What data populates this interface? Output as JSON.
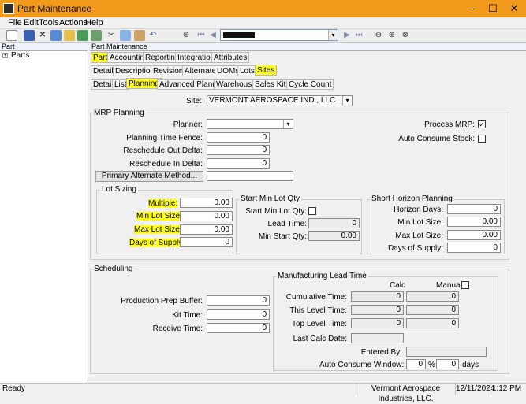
{
  "window": {
    "title": "Part Maintenance"
  },
  "menu": [
    "File",
    "Edit",
    "Tools",
    "Actions",
    "Help"
  ],
  "toolbar": {
    "search_value": ""
  },
  "left": {
    "header": "Part",
    "tree_item": "Parts"
  },
  "main": {
    "header": "Part Maintenance",
    "tabs1": [
      "Part",
      "Accounting",
      "Reporting",
      "Integrations",
      "Attributes"
    ],
    "tabs2": [
      "Detail",
      "Descriptions",
      "Revisions",
      "Alternates",
      "UOMs",
      "Lots",
      "Sites"
    ],
    "tabs3": [
      "Detail",
      "List",
      "Planning",
      "Advanced Planning",
      "Warehouses",
      "Sales Kits",
      "Cycle Count"
    ],
    "site_label": "Site:",
    "site_value": "VERMONT AEROSPACE IND., LLC",
    "mrp": {
      "title": "MRP Planning",
      "planner": "Planner:",
      "time_fence": "Planning Time Fence:",
      "time_fence_val": "0",
      "out_delta": "Reschedule Out Delta:",
      "out_delta_val": "0",
      "in_delta": "Reschedule In Delta:",
      "in_delta_val": "0",
      "primary_alt_btn": "Primary Alternate Method...",
      "process_mrp": "Process MRP:",
      "auto_consume": "Auto Consume Stock:"
    },
    "lot": {
      "title": "Lot Sizing",
      "multiple": "Multiple:",
      "multiple_val": "0.00",
      "min": "Min Lot Size:",
      "min_val": "0.00",
      "max": "Max Lot Size:",
      "max_val": "0.00",
      "days": "Days of Supply:",
      "days_val": "0"
    },
    "startmin": {
      "title": "Start Min Lot Qty",
      "start": "Start Min Lot Qty:",
      "lead": "Lead Time:",
      "lead_val": "0",
      "minstart": "Min Start Qty:",
      "minstart_val": "0.00"
    },
    "short": {
      "title": "Short Horizon Planning",
      "horizon": "Horizon Days:",
      "horizon_val": "0",
      "min": "Min Lot Size:",
      "min_val": "0.00",
      "max": "Max Lot Size:",
      "max_val": "0.00",
      "days": "Days of Supply:",
      "days_val": "0"
    },
    "sched": {
      "title": "Scheduling",
      "prod_prep": "Production Prep Buffer:",
      "prod_prep_val": "0",
      "kit": "Kit Time:",
      "kit_val": "0",
      "receive": "Receive Time:",
      "receive_val": "0"
    },
    "mlt": {
      "title": "Manufacturing Lead Time",
      "calc": "Calc",
      "manual": "Manual",
      "cumulative": "Cumulative Time:",
      "cum_calc": "0",
      "cum_man": "0",
      "thislevel": "This Level Time:",
      "this_calc": "0",
      "this_man": "0",
      "toplevel": "Top Level Time:",
      "top_calc": "0",
      "top_man": "0",
      "lastcalc": "Last Calc Date:",
      "enteredby": "Entered By:",
      "auto_window": "Auto Consume Window:",
      "auto_val": "0",
      "pct": "%",
      "auto_days_val": "0",
      "days": "days"
    }
  },
  "status": {
    "left": "Ready",
    "company": "Vermont Aerospace Industries, LLC.",
    "date": "12/11/2024",
    "time": "1:12 PM"
  }
}
